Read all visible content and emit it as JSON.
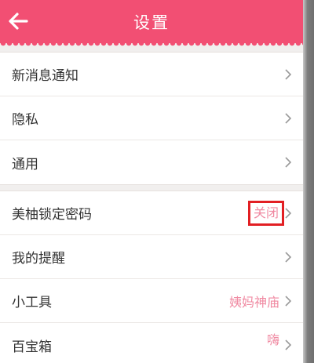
{
  "header": {
    "title": "设置",
    "back_icon": "arrow-left-icon"
  },
  "groups": [
    {
      "items": [
        {
          "label": "新消息通知",
          "value": ""
        },
        {
          "label": "隐私",
          "value": ""
        },
        {
          "label": "通用",
          "value": ""
        }
      ]
    },
    {
      "items": [
        {
          "label": "美柚锁定密码",
          "value": "关闭"
        },
        {
          "label": "我的提醒",
          "value": ""
        },
        {
          "label": "小工具",
          "value": "姨妈神庙"
        },
        {
          "label": "百宝箱",
          "value": "嗨"
        }
      ]
    }
  ],
  "colors": {
    "accent": "#f24f73",
    "value_pink": "#f08aa2",
    "highlight_box": "#e21f23"
  }
}
